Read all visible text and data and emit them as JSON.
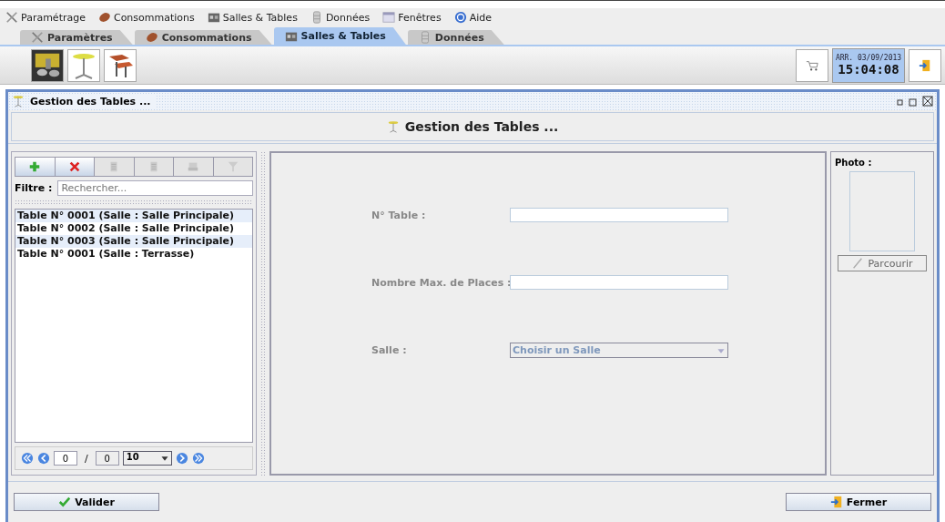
{
  "menu": [
    {
      "label": "Paramétrage"
    },
    {
      "label": "Consommations"
    },
    {
      "label": "Salles & Tables"
    },
    {
      "label": "Données"
    },
    {
      "label": "Fenêtres"
    },
    {
      "label": "Aide"
    }
  ],
  "tabs": [
    {
      "label": "Paramètres",
      "selected": false
    },
    {
      "label": "Consommations",
      "selected": false
    },
    {
      "label": "Salles & Tables",
      "selected": true
    },
    {
      "label": "Données",
      "selected": false
    }
  ],
  "clock": {
    "date": "ARR. 03/09/2013",
    "time": "15:04:08"
  },
  "frame": {
    "title": "Gestion des Tables ...",
    "header": "Gestion des Tables ..."
  },
  "list_toolbar": [
    {
      "disabled": false
    },
    {
      "disabled": false
    },
    {
      "disabled": true
    },
    {
      "disabled": true
    },
    {
      "disabled": true
    },
    {
      "disabled": true
    }
  ],
  "filter": {
    "label": "Filtre :",
    "placeholder": "Rechercher..."
  },
  "tables": [
    "Table N° 0001 (Salle : Salle Principale)",
    "Table N° 0002 (Salle : Salle Principale)",
    "Table N° 0003 (Salle : Salle Principale)",
    "Table N° 0001 (Salle : Terrasse)"
  ],
  "pager": {
    "page": "0",
    "separator": "/",
    "total": "0",
    "page_size": "10"
  },
  "form": {
    "fields": [
      {
        "label": "N° Table :",
        "kind": "text",
        "disabled": true
      },
      {
        "label": "Nombre Max. de Places :",
        "kind": "text",
        "disabled": true
      },
      {
        "label": "Salle :",
        "kind": "select",
        "value": "Choisir un Salle",
        "disabled": true
      }
    ]
  },
  "photo": {
    "title": "Photo :",
    "button": "Parcourir"
  },
  "buttons": [
    {
      "label": "Valider",
      "kind": "ok"
    },
    {
      "label": "Fermer",
      "kind": "close"
    }
  ]
}
